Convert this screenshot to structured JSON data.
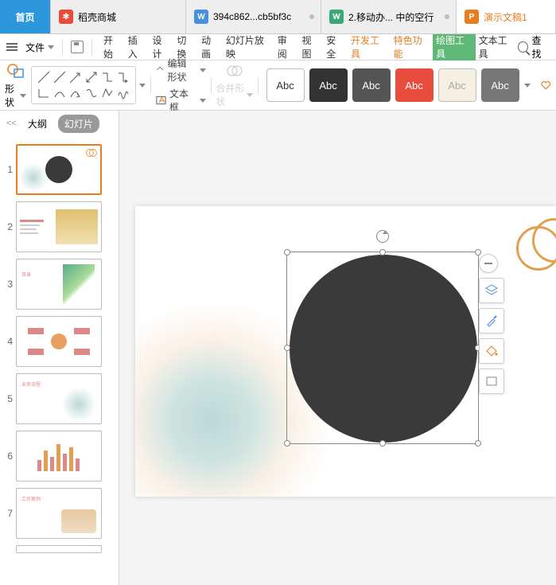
{
  "tabs": {
    "home": "首页",
    "store": "稻壳商城",
    "doc1": "394c862...cb5bf3c",
    "doc2": "2.移动办... 中的空行",
    "pres": "演示文稿1"
  },
  "file": {
    "label": "文件"
  },
  "menu": {
    "start": "开始",
    "insert": "插入",
    "design": "设计",
    "transition": "切换",
    "anim": "动画",
    "slideshow": "幻灯片放映",
    "review": "审阅",
    "view": "视图",
    "security": "安全",
    "dev": "开发工具",
    "special": "特色功能",
    "draw": "绘图工具",
    "text": "文本工具",
    "find": "查找"
  },
  "ribbon": {
    "shapes": "形状",
    "edit_shape": "编辑形状",
    "textbox": "文本框",
    "merge": "合并形状",
    "abc": "Abc"
  },
  "side": {
    "outline": "大纲",
    "slides": "幻灯片"
  },
  "thumbs": [
    "1",
    "2",
    "3",
    "4",
    "5",
    "6",
    "7"
  ]
}
